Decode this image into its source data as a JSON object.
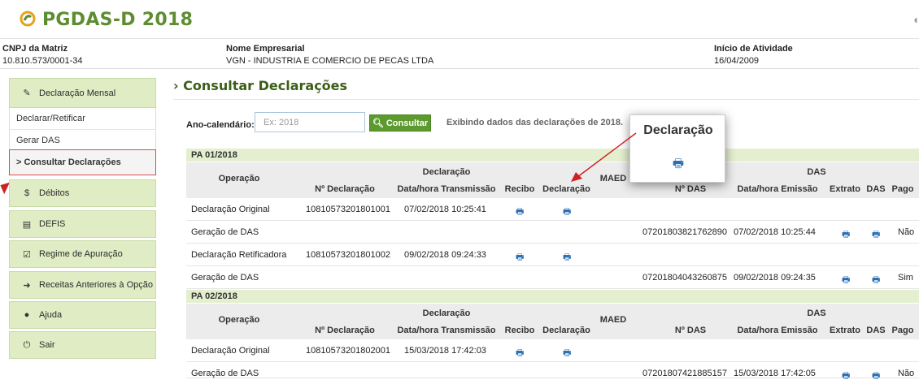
{
  "app": {
    "title": "PGDAS-D 2018"
  },
  "company": {
    "cnpj_label": "CNPJ da Matriz",
    "cnpj_value": "10.810.573/0001-34",
    "name_label": "Nome Empresarial",
    "name_value": "VGN - INDUSTRIA E COMERCIO DE PECAS LTDA",
    "start_label": "Início de Atividade",
    "start_value": "16/04/2009"
  },
  "sidebar": {
    "items": [
      {
        "label": "Declaração Mensal",
        "icon": "pencil-icon"
      },
      {
        "label": "Débitos",
        "icon": "dollar-icon"
      },
      {
        "label": "DEFIS",
        "icon": "list-icon"
      },
      {
        "label": "Regime de Apuração",
        "icon": "check-box-icon"
      },
      {
        "label": "Receitas Anteriores à Opção",
        "icon": "arrow-icon"
      },
      {
        "label": "Ajuda",
        "icon": "help-icon"
      },
      {
        "label": "Sair",
        "icon": "power-icon"
      }
    ],
    "subitems": [
      "Declarar/Retificar",
      "Gerar DAS",
      "> Consultar Declarações"
    ]
  },
  "main": {
    "title": "Consultar Declarações",
    "filter_label": "Ano-calendário:",
    "year_placeholder": "Ex: 2018",
    "consult_button": "Consultar",
    "showing_text": "Exibindo dados das declarações de 2018."
  },
  "table_headers": {
    "operacao": "Operação",
    "declaracao": "Declaração",
    "maed": "MAED",
    "das": "DAS",
    "n_declaracao": "Nº Declaração",
    "data_transmissao": "Data/hora Transmissão",
    "recibo": "Recibo",
    "declaracao_col": "Declaração",
    "n_das": "Nº DAS",
    "data_emissao": "Data/hora Emissão",
    "extrato": "Extrato",
    "das_col": "DAS",
    "pago": "Pago"
  },
  "periods": [
    {
      "label": "PA 01/2018",
      "rows": [
        {
          "operacao": "Declaração Original",
          "n_declaracao": "10810573201801001",
          "data_transmissao": "07/02/2018 10:25:41",
          "n_das": "",
          "data_emissao": "",
          "pago": ""
        },
        {
          "operacao": "Geração de DAS",
          "n_declaracao": "",
          "data_transmissao": "",
          "n_das": "07201803821762890",
          "data_emissao": "07/02/2018 10:25:44",
          "pago": "Não"
        },
        {
          "operacao": "Declaração Retificadora",
          "n_declaracao": "10810573201801002",
          "data_transmissao": "09/02/2018 09:24:33",
          "n_das": "",
          "data_emissao": "",
          "pago": ""
        },
        {
          "operacao": "Geração de DAS",
          "n_declaracao": "",
          "data_transmissao": "",
          "n_das": "07201804043260875",
          "data_emissao": "09/02/2018 09:24:35",
          "pago": "Sim"
        }
      ]
    },
    {
      "label": "PA 02/2018",
      "rows": [
        {
          "operacao": "Declaração Original",
          "n_declaracao": "10810573201802001",
          "data_transmissao": "15/03/2018 17:42:03",
          "n_das": "",
          "data_emissao": "",
          "pago": ""
        },
        {
          "operacao": "Geração de DAS",
          "n_declaracao": "",
          "data_transmissao": "",
          "n_das": "07201807421885157",
          "data_emissao": "15/03/2018 17:42:05",
          "pago": "Não"
        }
      ]
    }
  ],
  "popup": {
    "title": "Declaração",
    "icon": "printer-icon"
  },
  "colors": {
    "brand_green": "#5e8c31",
    "menu_bg": "#dfecc4",
    "highlight_red": "#cc2222",
    "print_blue": "#2a6fb5"
  }
}
